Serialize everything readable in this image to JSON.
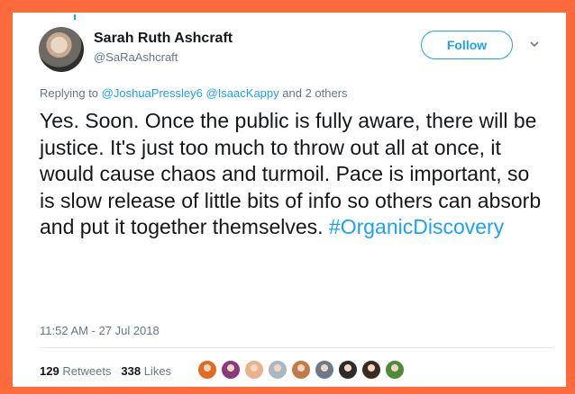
{
  "author": {
    "name": "Sarah Ruth Ashcraft",
    "handle": "@SaRaAshcraft"
  },
  "follow_label": "Follow",
  "reply": {
    "prefix": "Replying to",
    "mention1": "@JoshuaPressley6",
    "mention2": "@IsaacKappy",
    "suffix": "and 2 others"
  },
  "tweet": {
    "text": "Yes. Soon. Once the public is fully aware, there will be justice. It's just too much to throw out all at once, it would cause chaos and turmoil. Pace is important, so is slow release of little bits of info so others can absorb and put it together themselves.",
    "hashtag": "#OrganicDiscovery"
  },
  "timestamp": "11:52 AM - 27 Jul 2018",
  "stats": {
    "retweets_count": "129",
    "retweets_label": "Retweets",
    "likes_count": "338",
    "likes_label": "Likes"
  },
  "likers": [
    {
      "color": "#e36b1d"
    },
    {
      "color": "#8c3a7a"
    },
    {
      "color": "#e8b38c"
    },
    {
      "color": "#aab8c2"
    },
    {
      "color": "#c47a48"
    },
    {
      "color": "#6b7b8c"
    },
    {
      "color": "#2c2c2c"
    },
    {
      "color": "#3a2a20"
    },
    {
      "color": "#4f8a3a"
    }
  ],
  "colors": {
    "accent": "#1da1f2",
    "frame": "#ff6a3d"
  }
}
